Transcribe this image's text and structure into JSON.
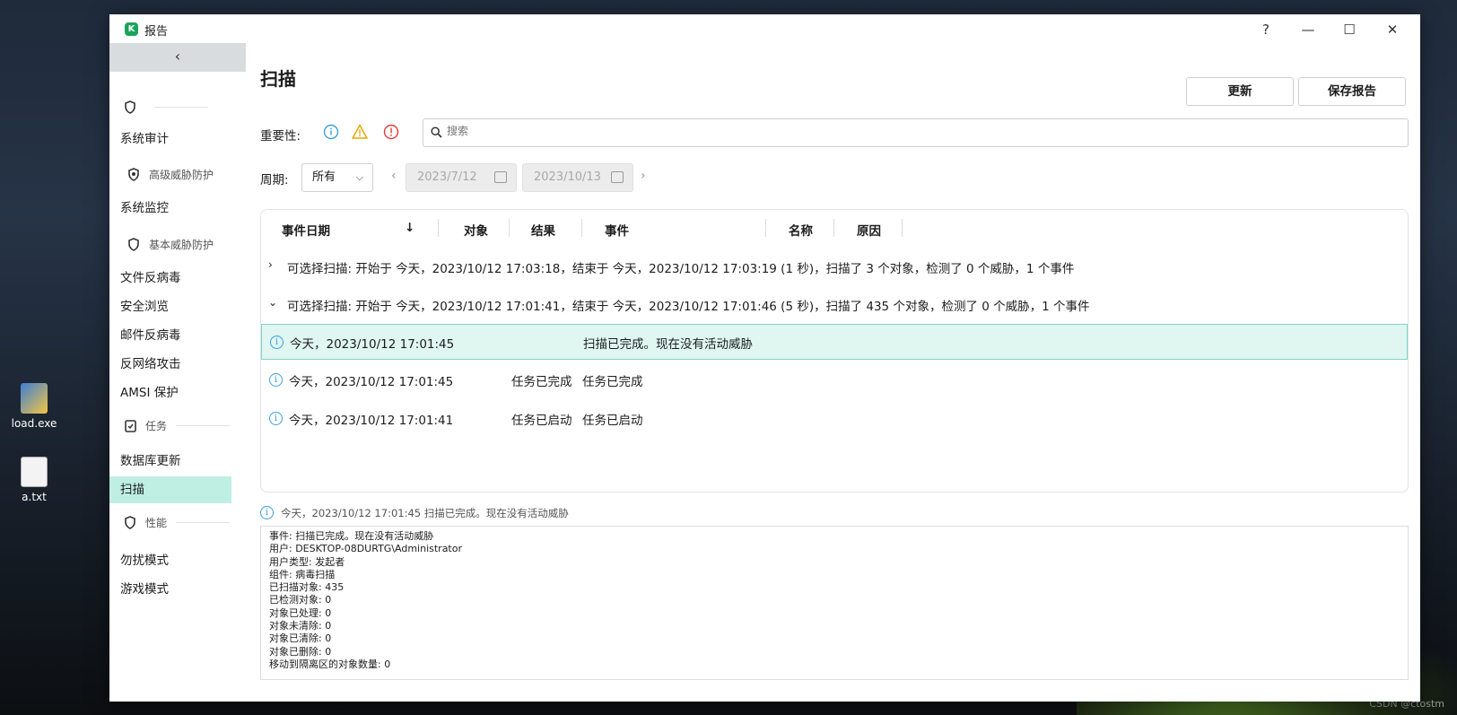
{
  "desktop": {
    "icons": [
      {
        "label": "load.exe"
      },
      {
        "label": "a.txt"
      }
    ],
    "watermark": "CSDN @ctostm"
  },
  "window": {
    "app_logo": "K",
    "title": "报告",
    "controls": {
      "help": "?",
      "minimize": "—",
      "maximize": "☐",
      "close": "✕"
    }
  },
  "sidebar": {
    "collapse": "‹",
    "groups": [
      {
        "label": ""
      },
      {
        "label": "高级威胁防护"
      },
      {
        "label": "基本威胁防护"
      },
      {
        "label": "任务"
      },
      {
        "label": "性能"
      }
    ],
    "items": {
      "system_audit": "系统审计",
      "system_monitor": "系统监控",
      "file_av": "文件反病毒",
      "safe_browse": "安全浏览",
      "mail_av": "邮件反病毒",
      "net_attack": "反网络攻击",
      "amsi": "AMSI 保护",
      "db_update": "数据库更新",
      "scan": "扫描",
      "do_not_disturb": "勿扰模式",
      "game_mode": "游戏模式"
    }
  },
  "main": {
    "title": "扫描",
    "buttons": {
      "refresh": "更新",
      "save_report": "保存报告"
    },
    "severity_label": "重要性:",
    "search_placeholder": "搜索",
    "period_label": "周期:",
    "period_value": "所有",
    "date_from": "2023/7/12",
    "date_to": "2023/10/13",
    "columns": {
      "date": "事件日期",
      "sort": "↓",
      "object": "对象",
      "result": "结果",
      "event": "事件",
      "name": "名称",
      "reason": "原因"
    },
    "groups": [
      {
        "caret": "›",
        "text": "可选择扫描: 开始于 今天，2023/10/12 17:03:18，结束于 今天，2023/10/12 17:03:19 (1 秒)，扫描了 3 个对象，检测了 0 个威胁，1 个事件"
      },
      {
        "caret": "⌄",
        "text": "可选择扫描: 开始于 今天，2023/10/12 17:01:41，结束于 今天，2023/10/12 17:01:46 (5 秒)，扫描了 435 个对象，检测了 0 个威胁，1 个事件"
      }
    ],
    "rows": [
      {
        "date": "今天，2023/10/12 17:01:45",
        "result": "",
        "event": "扫描已完成。现在没有活动威胁"
      },
      {
        "date": "今天，2023/10/12 17:01:45",
        "result": "任务已完成",
        "event": "任务已完成"
      },
      {
        "date": "今天，2023/10/12 17:01:41",
        "result": "任务已启动",
        "event": "任务已启动"
      }
    ],
    "detail_header": "今天，2023/10/12 17:01:45 扫描已完成。现在没有活动威胁",
    "detail_lines": [
      "事件: 扫描已完成。现在没有活动威胁",
      "用户: DESKTOP-08DURTG\\Administrator",
      "用户类型: 发起者",
      "组件: 病毒扫描",
      "已扫描对象: 435",
      "已检测对象: 0",
      "对象已处理: 0",
      "对象未清除: 0",
      "对象已清除: 0",
      "对象已删除: 0",
      "移动到隔离区的对象数量: 0"
    ],
    "colors": {
      "accent": "#1aa35a",
      "selected_row": "#dff6f1",
      "sidebar_active": "#bfeee3",
      "info": "#3a9fe0",
      "warning": "#e6a700",
      "critical": "#e03a3a"
    }
  }
}
